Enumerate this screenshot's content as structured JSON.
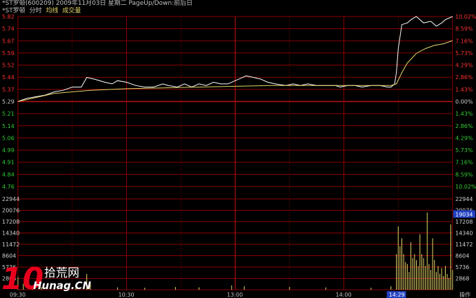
{
  "header": {
    "line1": "*ST罗顿(600209) 2009年11月03日 星期二 PageUp/Down:前后日",
    "stock_name": "*ST罗顿",
    "tab_minute": "分时",
    "tab_avg": "均线",
    "tab_volume": "成交量"
  },
  "colors": {
    "background": "#000000",
    "grid_red": "#8b0000",
    "price_line": "#ffffff",
    "avg_line": "#e8d66a",
    "up_text": "#ff3030",
    "down_text": "#33cc33",
    "volume_bar": "#e8d66a",
    "axis_blue": "#2040c0"
  },
  "chart_data": {
    "type": "line",
    "title": "",
    "prev_close": 5.29,
    "price_ticks": [
      "5.82",
      "5.74",
      "5.67",
      "5.59",
      "5.52",
      "5.44",
      "5.37",
      "5.29",
      "5.21",
      "5.14",
      "5.06",
      "4.99",
      "4.91",
      "4.84",
      "4.76"
    ],
    "pct_ticks": [
      "10.02%",
      "8.59%",
      "7.16%",
      "5.73%",
      "4.29%",
      "2.86%",
      "1.43%",
      "0.00%",
      "1.43%",
      "2.86%",
      "4.29%",
      "5.73%",
      "7.16%",
      "8.59%",
      "10.02%"
    ],
    "volume_ticks": [
      "22944",
      "20076",
      "17208",
      "14340",
      "11472",
      "8604",
      "5736",
      "2868"
    ],
    "time_labels": [
      "09:30",
      "10:30",
      "13:00",
      "14:00"
    ],
    "cursor_time": "14:29",
    "cursor_volume": "19034",
    "corner_label": "操作",
    "ylim": [
      4.76,
      5.82
    ],
    "volume_ylim": [
      0,
      22944
    ],
    "minutes": 240,
    "series": [
      {
        "key": "price",
        "points": [
          [
            0,
            5.29
          ],
          [
            5,
            5.31
          ],
          [
            10,
            5.32
          ],
          [
            15,
            5.33
          ],
          [
            20,
            5.35
          ],
          [
            25,
            5.36
          ],
          [
            30,
            5.38
          ],
          [
            35,
            5.38
          ],
          [
            38,
            5.44
          ],
          [
            42,
            5.43
          ],
          [
            48,
            5.41
          ],
          [
            52,
            5.4
          ],
          [
            55,
            5.42
          ],
          [
            60,
            5.41
          ],
          [
            65,
            5.39
          ],
          [
            70,
            5.38
          ],
          [
            75,
            5.38
          ],
          [
            80,
            5.4
          ],
          [
            83,
            5.39
          ],
          [
            88,
            5.38
          ],
          [
            92,
            5.4
          ],
          [
            96,
            5.38
          ],
          [
            100,
            5.4
          ],
          [
            104,
            5.39
          ],
          [
            108,
            5.41
          ],
          [
            112,
            5.4
          ],
          [
            116,
            5.4
          ],
          [
            120,
            5.42
          ],
          [
            122,
            5.43
          ],
          [
            126,
            5.45
          ],
          [
            130,
            5.44
          ],
          [
            134,
            5.43
          ],
          [
            138,
            5.41
          ],
          [
            142,
            5.4
          ],
          [
            148,
            5.39
          ],
          [
            152,
            5.4
          ],
          [
            156,
            5.39
          ],
          [
            160,
            5.4
          ],
          [
            165,
            5.39
          ],
          [
            170,
            5.39
          ],
          [
            175,
            5.39
          ],
          [
            178,
            5.38
          ],
          [
            182,
            5.39
          ],
          [
            186,
            5.39
          ],
          [
            190,
            5.38
          ],
          [
            195,
            5.39
          ],
          [
            200,
            5.39
          ],
          [
            204,
            5.38
          ],
          [
            206,
            5.38
          ],
          [
            208,
            5.4
          ],
          [
            209,
            5.47
          ],
          [
            210,
            5.62
          ],
          [
            212,
            5.77
          ],
          [
            215,
            5.78
          ],
          [
            217,
            5.8
          ],
          [
            220,
            5.82
          ],
          [
            224,
            5.78
          ],
          [
            228,
            5.79
          ],
          [
            231,
            5.76
          ],
          [
            234,
            5.78
          ],
          [
            236,
            5.8
          ],
          [
            240,
            5.82
          ]
        ]
      },
      {
        "key": "avg",
        "points": [
          [
            0,
            5.29
          ],
          [
            20,
            5.34
          ],
          [
            40,
            5.36
          ],
          [
            60,
            5.37
          ],
          [
            80,
            5.375
          ],
          [
            100,
            5.38
          ],
          [
            120,
            5.385
          ],
          [
            140,
            5.39
          ],
          [
            160,
            5.39
          ],
          [
            180,
            5.39
          ],
          [
            200,
            5.39
          ],
          [
            206,
            5.39
          ],
          [
            209,
            5.4
          ],
          [
            212,
            5.47
          ],
          [
            215,
            5.53
          ],
          [
            220,
            5.59
          ],
          [
            225,
            5.62
          ],
          [
            230,
            5.64
          ],
          [
            235,
            5.65
          ],
          [
            240,
            5.67
          ]
        ]
      }
    ],
    "volume": [
      [
        0,
        3200
      ],
      [
        3,
        1500
      ],
      [
        8,
        900
      ],
      [
        13,
        700
      ],
      [
        20,
        600
      ],
      [
        28,
        800
      ],
      [
        32,
        1200
      ],
      [
        38,
        4000
      ],
      [
        40,
        1500
      ],
      [
        55,
        600
      ],
      [
        70,
        500
      ],
      [
        87,
        700
      ],
      [
        100,
        600
      ],
      [
        118,
        1100
      ],
      [
        125,
        900
      ],
      [
        150,
        700
      ],
      [
        170,
        600
      ],
      [
        195,
        500
      ],
      [
        206,
        900
      ],
      [
        209,
        9000
      ],
      [
        210,
        16000
      ],
      [
        211,
        11000
      ],
      [
        212,
        13000
      ],
      [
        213,
        9000
      ],
      [
        214,
        7000
      ],
      [
        215,
        6500
      ],
      [
        216,
        4500
      ],
      [
        217,
        12000
      ],
      [
        218,
        8000
      ],
      [
        219,
        9000
      ],
      [
        220,
        7500
      ],
      [
        221,
        6000
      ],
      [
        222,
        14000
      ],
      [
        223,
        9000
      ],
      [
        224,
        8000
      ],
      [
        225,
        6000
      ],
      [
        226,
        19500
      ],
      [
        227,
        6500
      ],
      [
        228,
        5000
      ],
      [
        229,
        13000
      ],
      [
        230,
        7500
      ],
      [
        231,
        4500
      ],
      [
        232,
        6000
      ],
      [
        233,
        4000
      ],
      [
        234,
        5500
      ],
      [
        235,
        3500
      ],
      [
        236,
        6000
      ],
      [
        237,
        4000
      ],
      [
        238,
        3000
      ],
      [
        239,
        16500
      ],
      [
        240,
        5000
      ]
    ]
  }
}
